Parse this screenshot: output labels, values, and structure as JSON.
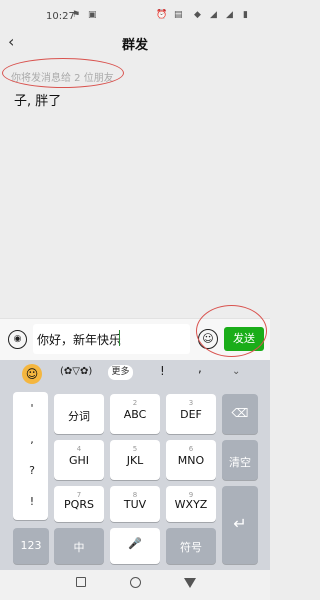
{
  "status_bar": {
    "time": "10:27"
  },
  "header": {
    "back_icon": "‹",
    "title": "群发"
  },
  "message": {
    "hint": "你将发消息给 2 位朋友",
    "recipients": "子, 胖了"
  },
  "input_bar": {
    "value": "你好，新年快乐",
    "send_label": "发送"
  },
  "keyboard": {
    "toolbar": {
      "face": "(✿▽✿)",
      "more": "更多",
      "exclaim": "!",
      "comma": ","
    },
    "punct": [
      "'",
      ",",
      "?",
      "!"
    ],
    "keys": {
      "fenci": "分词",
      "abc": "ABC",
      "abc_sup": "2",
      "def": "DEF",
      "def_sup": "3",
      "ghi": "GHI",
      "ghi_sup": "4",
      "jkl": "JKL",
      "jkl_sup": "5",
      "mno": "MNO",
      "mno_sup": "6",
      "pqrs": "PQRS",
      "pqrs_sup": "7",
      "tuv": "TUV",
      "tuv_sup": "8",
      "wxyz": "WXYZ",
      "wxyz_sup": "9",
      "clear": "清空",
      "num": "123",
      "zhong": "中",
      "fuhao": "符号"
    }
  },
  "colors": {
    "accent": "#1aad19",
    "annotation": "#d9534f"
  }
}
